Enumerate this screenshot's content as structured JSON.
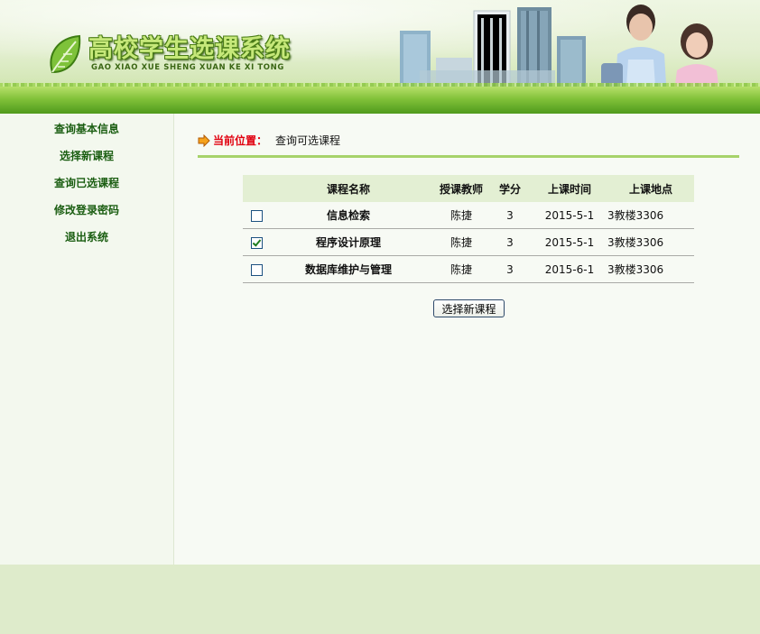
{
  "header": {
    "title": "高校学生选课系统",
    "subtitle": "GAO XIAO XUE SHENG XUAN KE XI TONG"
  },
  "sidebar": {
    "items": [
      {
        "label": "查询基本信息"
      },
      {
        "label": "选择新课程"
      },
      {
        "label": "查询已选课程"
      },
      {
        "label": "修改登录密码"
      },
      {
        "label": "退出系统"
      }
    ]
  },
  "breadcrumb": {
    "label": "当前位置：",
    "value": "查询可选课程"
  },
  "table": {
    "headers": [
      "课程名称",
      "授课教师",
      "学分",
      "上课时间",
      "上课地点"
    ],
    "rows": [
      {
        "checked": false,
        "name": "信息检索",
        "teacher": "陈捷",
        "credit": "3",
        "time": "2015-5-1",
        "place": "3教楼3306"
      },
      {
        "checked": true,
        "name": "程序设计原理",
        "teacher": "陈捷",
        "credit": "3",
        "time": "2015-5-1",
        "place": "3教楼3306"
      },
      {
        "checked": false,
        "name": "数据库维护与管理",
        "teacher": "陈捷",
        "credit": "3",
        "time": "2015-6-1",
        "place": "3教楼3306"
      }
    ]
  },
  "actions": {
    "submit_label": "选择新课程"
  },
  "colors": {
    "accent_green": "#1b5e12",
    "breadcrumb_red": "#e1000f",
    "divider_green": "#a6d26a",
    "header_row": "#e3efd3",
    "footer": "#deebcb"
  },
  "icons": {
    "logo": "leaf-icon",
    "breadcrumb": "arrow-right-icon"
  }
}
